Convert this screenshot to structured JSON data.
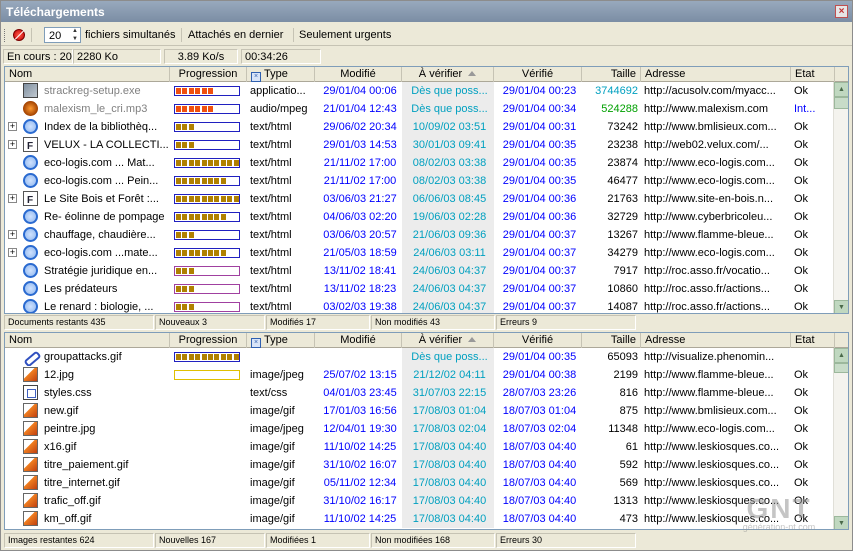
{
  "window": {
    "title": "Téléchargements"
  },
  "toolbar": {
    "simultaneous_value": "20",
    "simultaneous_label": "fichiers simultanés",
    "attach_last_label": "Attachés en dernier",
    "urgent_only_label": "Seulement urgents"
  },
  "infobar": {
    "in_progress": "En cours : 20",
    "size": "2280 Ko",
    "speed": "3.89 Ko/s",
    "elapsed": "00:34:26"
  },
  "columns": {
    "name": "Nom",
    "progress": "Progression",
    "type": "Type",
    "modified": "Modifié",
    "to_verify": "À vérifier",
    "verified": "Vérifié",
    "size": "Taille",
    "address": "Adresse",
    "state": "Etat"
  },
  "documents": [
    {
      "name": "strackreg-setup.exe",
      "icon": "exe-icon",
      "expand": false,
      "progress": 0.62,
      "bar": "blue",
      "seg": "#f05010",
      "type": "applicatio...",
      "modified": "29/01/04 00:06",
      "to_verify": "Dès que poss...",
      "verified": "29/01/04 00:23",
      "size": "3744692",
      "address": "http://acusolv.com/myacc...",
      "state": "Ok",
      "style": "gray",
      "size_style": "teal"
    },
    {
      "name": "malexism_le_cri.mp3",
      "icon": "mp3-icon",
      "expand": false,
      "progress": 0.62,
      "bar": "blue",
      "seg": "#f05010",
      "type": "audio/mpeg",
      "modified": "21/01/04 12:43",
      "to_verify": "Dès que poss...",
      "verified": "29/01/04 00:34",
      "size": "524288",
      "address": "http://www.malexism.com",
      "state": "Int...",
      "style": "gray",
      "size_style": "green"
    },
    {
      "name": "Index de la bibliothèq...",
      "icon": "ie-icon",
      "expand": true,
      "progress": 0.25,
      "bar": "blue",
      "seg": "#b08000",
      "type": "text/html",
      "modified": "29/06/02 20:34",
      "to_verify": "10/09/02 03:51",
      "verified": "29/01/04 00:31",
      "size": "73242",
      "address": "http://www.bmlisieux.com...",
      "state": "Ok"
    },
    {
      "name": "VELUX - LA COLLECTI...",
      "icon": "doc-icon",
      "expand": true,
      "progress": 0.25,
      "bar": "blue",
      "seg": "#b08000",
      "type": "text/html",
      "modified": "29/01/03 14:53",
      "to_verify": "30/01/03 09:41",
      "verified": "29/01/04 00:35",
      "size": "23238",
      "address": "http://web02.velux.com/...",
      "state": "Ok"
    },
    {
      "name": "eco-logis.com ... Mat...",
      "icon": "ie-icon",
      "expand": false,
      "progress": 1.0,
      "bar": "blue",
      "seg": "#b08000",
      "type": "text/html",
      "modified": "21/11/02 17:00",
      "to_verify": "08/02/03 03:38",
      "verified": "29/01/04 00:35",
      "size": "23874",
      "address": "http://www.eco-logis.com...",
      "state": "Ok"
    },
    {
      "name": "eco-logis.com ... Pein...",
      "icon": "ie-icon",
      "expand": false,
      "progress": 0.75,
      "bar": "blue",
      "seg": "#b08000",
      "type": "text/html",
      "modified": "21/11/02 17:00",
      "to_verify": "08/02/03 03:38",
      "verified": "29/01/04 00:35",
      "size": "46477",
      "address": "http://www.eco-logis.com...",
      "state": "Ok"
    },
    {
      "name": "Le Site Bois et Forêt :...",
      "icon": "doc-icon",
      "expand": true,
      "progress": 1.0,
      "bar": "blue",
      "seg": "#b08000",
      "type": "text/html",
      "modified": "03/06/03 21:27",
      "to_verify": "06/06/03 08:45",
      "verified": "29/01/04 00:36",
      "size": "21763",
      "address": "http://www.site-en-bois.n...",
      "state": "Ok"
    },
    {
      "name": "Re- éolinne de pompage",
      "icon": "ie-icon",
      "expand": false,
      "progress": 0.75,
      "bar": "blue",
      "seg": "#b08000",
      "type": "text/html",
      "modified": "04/06/03 02:20",
      "to_verify": "19/06/03 02:28",
      "verified": "29/01/04 00:36",
      "size": "32729",
      "address": "http://www.cyberbricoleu...",
      "state": "Ok"
    },
    {
      "name": "chauffage, chaudière...",
      "icon": "ie-icon",
      "expand": true,
      "progress": 0.3,
      "bar": "blue",
      "seg": "#b08000",
      "type": "text/html",
      "modified": "03/06/03 20:57",
      "to_verify": "21/06/03 09:36",
      "verified": "29/01/04 00:37",
      "size": "13267",
      "address": "http://www.flamme-bleue...",
      "state": "Ok"
    },
    {
      "name": "eco-logis.com ...mate...",
      "icon": "ie-icon",
      "expand": true,
      "progress": 0.75,
      "bar": "blue",
      "seg": "#b08000",
      "type": "text/html",
      "modified": "21/05/03 18:59",
      "to_verify": "24/06/03 03:11",
      "verified": "29/01/04 00:37",
      "size": "34279",
      "address": "http://www.eco-logis.com...",
      "state": "Ok"
    },
    {
      "name": "Stratégie juridique en...",
      "icon": "ie-icon",
      "expand": false,
      "progress": 0.3,
      "bar": "purple",
      "seg": "#b08000",
      "type": "text/html",
      "modified": "13/11/02 18:41",
      "to_verify": "24/06/03 04:37",
      "verified": "29/01/04 00:37",
      "size": "7917",
      "address": "http://roc.asso.fr/vocatio...",
      "state": "Ok"
    },
    {
      "name": "Les prédateurs",
      "icon": "ie-icon",
      "expand": false,
      "progress": 0.25,
      "bar": "purple",
      "seg": "#b08000",
      "type": "text/html",
      "modified": "13/11/02 18:23",
      "to_verify": "24/06/03 04:37",
      "verified": "29/01/04 00:37",
      "size": "10860",
      "address": "http://roc.asso.fr/actions...",
      "state": "Ok"
    },
    {
      "name": "Le renard : biologie, ...",
      "icon": "ie-icon",
      "expand": false,
      "progress": 0.25,
      "bar": "purple",
      "seg": "#b08000",
      "type": "text/html",
      "modified": "03/02/03 19:38",
      "to_verify": "24/06/03 04:37",
      "verified": "29/01/04 00:37",
      "size": "14087",
      "address": "http://roc.asso.fr/actions...",
      "state": "Ok"
    }
  ],
  "doc_status": {
    "remaining": "Documents restants 435",
    "new": "Nouveaux 3",
    "modified": "Modifiés 17",
    "unmodified": "Non modifiés 43",
    "errors": "Erreurs 9"
  },
  "images": [
    {
      "name": "groupattacks.gif",
      "icon": "link-icon",
      "progress": 1.0,
      "bar": "blue",
      "seg": "#b08000",
      "type": "",
      "modified": "",
      "to_verify": "Dès que poss...",
      "verified": "29/01/04 00:35",
      "size": "65093",
      "address": "http://visualize.phenomin...",
      "state": ""
    },
    {
      "name": "12.jpg",
      "icon": "image-icon",
      "progress": 0.0,
      "bar": "yellow",
      "seg": "#b08000",
      "type": "image/jpeg",
      "modified": "25/07/02 13:15",
      "to_verify": "21/12/02 04:11",
      "verified": "29/01/04 00:38",
      "size": "2199",
      "address": "http://www.flamme-bleue...",
      "state": "Ok"
    },
    {
      "name": "styles.css",
      "icon": "css-icon",
      "progress": null,
      "type": "text/css",
      "modified": "04/01/03 23:45",
      "to_verify": "31/07/03 22:15",
      "verified": "28/07/03 23:26",
      "size": "816",
      "address": "http://www.flamme-bleue...",
      "state": "Ok"
    },
    {
      "name": "new.gif",
      "icon": "image-icon",
      "progress": null,
      "type": "image/gif",
      "modified": "17/01/03 16:56",
      "to_verify": "17/08/03 01:04",
      "verified": "18/07/03 01:04",
      "size": "875",
      "address": "http://www.bmlisieux.com...",
      "state": "Ok"
    },
    {
      "name": "peintre.jpg",
      "icon": "image-icon",
      "progress": null,
      "type": "image/jpeg",
      "modified": "12/04/01 19:30",
      "to_verify": "17/08/03 02:04",
      "verified": "18/07/03 02:04",
      "size": "11348",
      "address": "http://www.eco-logis.com...",
      "state": "Ok"
    },
    {
      "name": "x16.gif",
      "icon": "image-icon",
      "progress": null,
      "type": "image/gif",
      "modified": "11/10/02 14:25",
      "to_verify": "17/08/03 04:40",
      "verified": "18/07/03 04:40",
      "size": "61",
      "address": "http://www.leskiosques.co...",
      "state": "Ok"
    },
    {
      "name": "titre_paiement.gif",
      "icon": "image-icon",
      "progress": null,
      "type": "image/gif",
      "modified": "31/10/02 16:07",
      "to_verify": "17/08/03 04:40",
      "verified": "18/07/03 04:40",
      "size": "592",
      "address": "http://www.leskiosques.co...",
      "state": "Ok"
    },
    {
      "name": "titre_internet.gif",
      "icon": "image-icon",
      "progress": null,
      "type": "image/gif",
      "modified": "05/11/02 12:34",
      "to_verify": "17/08/03 04:40",
      "verified": "18/07/03 04:40",
      "size": "569",
      "address": "http://www.leskiosques.co...",
      "state": "Ok"
    },
    {
      "name": "trafic_off.gif",
      "icon": "image-icon",
      "progress": null,
      "type": "image/gif",
      "modified": "31/10/02 16:17",
      "to_verify": "17/08/03 04:40",
      "verified": "18/07/03 04:40",
      "size": "1313",
      "address": "http://www.leskiosques.co...",
      "state": "Ok"
    },
    {
      "name": "km_off.gif",
      "icon": "image-icon",
      "progress": null,
      "type": "image/gif",
      "modified": "11/10/02 14:25",
      "to_verify": "17/08/03 04:40",
      "verified": "18/07/03 04:40",
      "size": "473",
      "address": "http://www.leskiosques.co...",
      "state": "Ok"
    }
  ],
  "img_status": {
    "remaining": "Images restantes 624",
    "new": "Nouvelles 167",
    "modified": "Modifiées 1",
    "unmodified": "Non modifiées 168",
    "errors": "Erreurs 30"
  },
  "watermark": {
    "brand": "GNT",
    "site": "génération-nt.com"
  },
  "colors": {
    "bar_blue": "#2020c0",
    "bar_purple": "#a040a0",
    "bar_yellow": "#e0c000",
    "verify_bg": "#ececec"
  }
}
